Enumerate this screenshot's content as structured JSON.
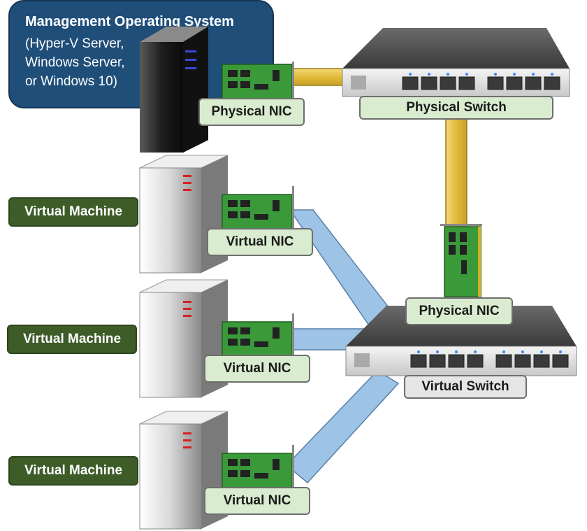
{
  "management_os": {
    "title": "Management Operating System",
    "lines": [
      "(Hyper-V Server,",
      "Windows Server,",
      "or Windows 10)"
    ],
    "nic_label": "Physical NIC"
  },
  "physical_switch": {
    "label": "Physical Switch",
    "ports": 8
  },
  "virtual_switch": {
    "label": "Virtual Switch",
    "uplink_nic_label": "Physical NIC",
    "ports": 8
  },
  "virtual_machines": [
    {
      "label": "Virtual Machine",
      "nic_label": "Virtual NIC"
    },
    {
      "label": "Virtual Machine",
      "nic_label": "Virtual NIC"
    },
    {
      "label": "Virtual Machine",
      "nic_label": "Virtual NIC"
    }
  ],
  "links": [
    {
      "from": "management-physical-nic",
      "to": "physical-switch",
      "kind": "physical"
    },
    {
      "from": "physical-switch",
      "to": "virtual-switch-physical-nic",
      "kind": "physical"
    },
    {
      "from": "vm-1-virtual-nic",
      "to": "virtual-switch",
      "kind": "virtual"
    },
    {
      "from": "vm-2-virtual-nic",
      "to": "virtual-switch",
      "kind": "virtual"
    },
    {
      "from": "vm-3-virtual-nic",
      "to": "virtual-switch",
      "kind": "virtual"
    }
  ],
  "colors": {
    "physical_link": "#e8c447",
    "virtual_link": "#9dc3e6",
    "mgmt_box": "#1f4e79",
    "vm_label": "#3d5c28",
    "nic_label_bg": "#d9ecd0",
    "vswitch_label_bg": "#e6e6e6",
    "nic_board": "#3a9a3a",
    "server_accent_mgmt": "#3a4bd8",
    "server_accent_vm": "#d62020"
  }
}
